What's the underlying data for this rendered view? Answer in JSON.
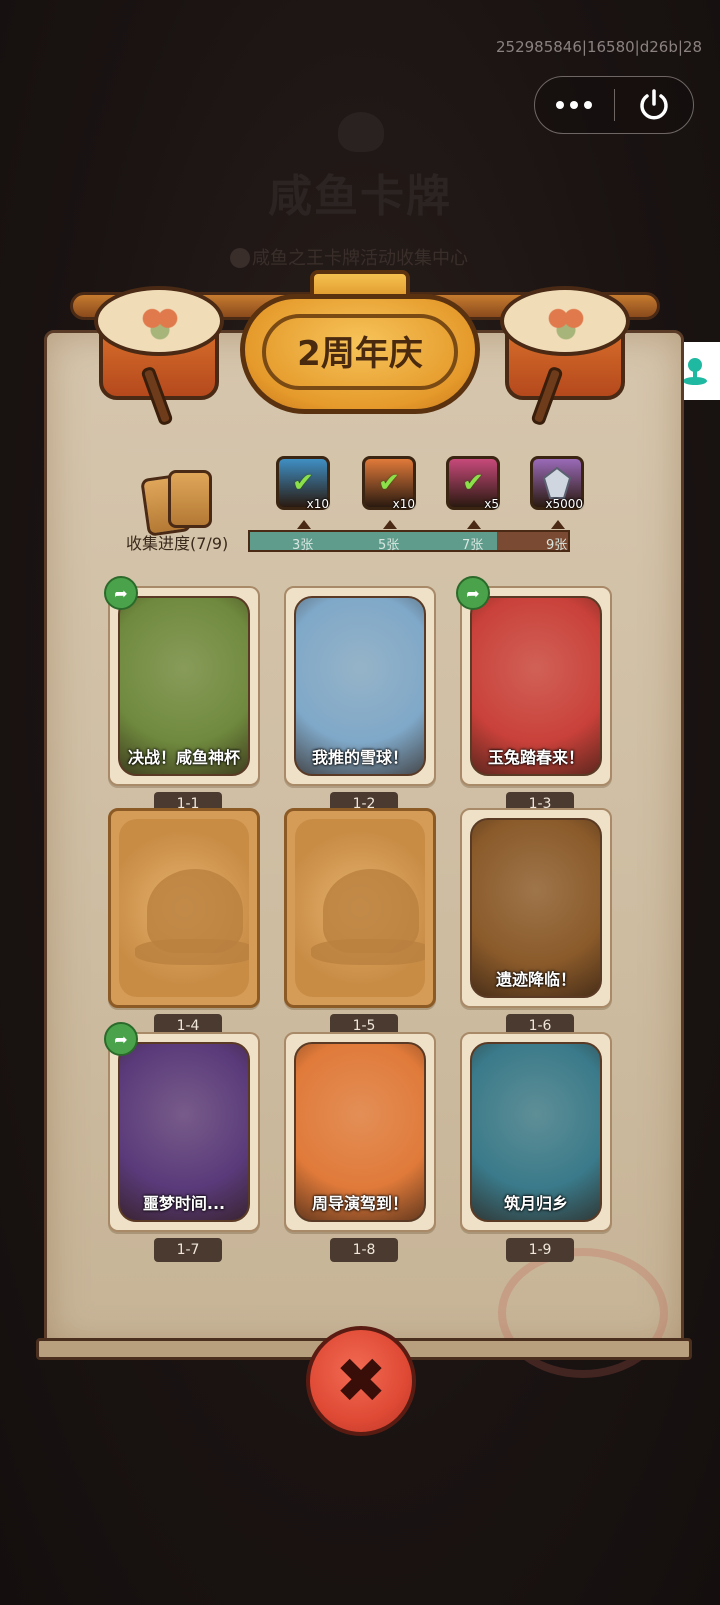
{
  "background": {
    "title": "咸鱼卡牌",
    "subtitle": "咸鱼之王卡牌活动收集中心"
  },
  "debug_id": "252985846|16580|d26b|28",
  "capsule": {
    "more_icon": "more-dots-icon",
    "close_icon": "power-icon"
  },
  "float_icon": "joystick-icon",
  "header": {
    "title": "2周年庆"
  },
  "progress": {
    "label": "收集进度(7/9)",
    "collected": 7,
    "total": 9,
    "rewards": [
      {
        "qty": "x10",
        "threshold": "3张",
        "claimed": true,
        "color": "#3f8fc4",
        "icon": "treasure-chest-icon"
      },
      {
        "qty": "x10",
        "threshold": "5张",
        "claimed": true,
        "color": "#e07a3a",
        "icon": "key-icon"
      },
      {
        "qty": "x5",
        "threshold": "7张",
        "claimed": true,
        "color": "#c74a7a",
        "icon": "orb-icon"
      },
      {
        "qty": "x5000",
        "threshold": "9张",
        "claimed": false,
        "color": "#9a6ab8",
        "icon": "crystal-icon"
      }
    ]
  },
  "cards": [
    {
      "title": "决战！咸鱼神杯",
      "num": "1-1",
      "locked": false,
      "share": true,
      "bg": "#6f8a3e"
    },
    {
      "title": "我推的雪球！",
      "num": "1-2",
      "locked": false,
      "share": false,
      "bg": "#7fa8c8"
    },
    {
      "title": "玉兔踏春来！",
      "num": "1-3",
      "locked": false,
      "share": true,
      "bg": "#c9413a"
    },
    {
      "title": "",
      "num": "1-4",
      "locked": true,
      "share": false,
      "bg": "#d49c57"
    },
    {
      "title": "",
      "num": "1-5",
      "locked": true,
      "share": false,
      "bg": "#d49c57"
    },
    {
      "title": "遗迹降临！",
      "num": "1-6",
      "locked": false,
      "share": false,
      "bg": "#8a5a2a"
    },
    {
      "title": "噩梦时间...",
      "num": "1-7",
      "locked": false,
      "share": true,
      "bg": "#5a3a7a"
    },
    {
      "title": "周导演驾到！",
      "num": "1-8",
      "locked": false,
      "share": false,
      "bg": "#e07a3a"
    },
    {
      "title": "筑月归乡",
      "num": "1-9",
      "locked": false,
      "share": false,
      "bg": "#3a7a8a"
    }
  ],
  "close_button": {
    "icon": "close-x-icon"
  }
}
